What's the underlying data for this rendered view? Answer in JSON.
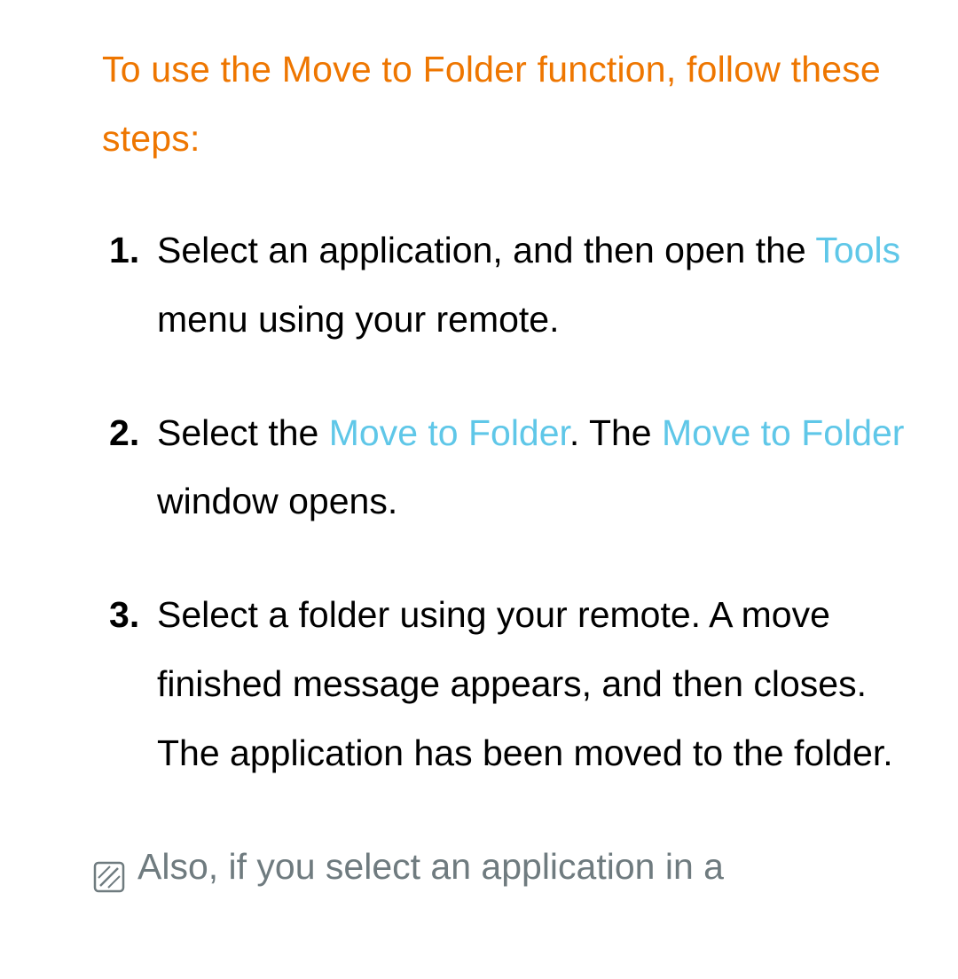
{
  "heading": "To use the Move to Folder function, follow these steps:",
  "steps": {
    "s1": {
      "p1": "Select an application, and then open the ",
      "hl1": "Tools",
      "p2": " menu using your remote."
    },
    "s2": {
      "p1": "Select the ",
      "hl1": "Move to Folder",
      "p2": ". The ",
      "hl2": "Move to Folder",
      "p3": " window opens."
    },
    "s3": {
      "p1": "Select a folder using your remote. A move finished message appears, and then closes. The application has been moved to the folder."
    }
  },
  "note": "Also, if you select an application in a"
}
